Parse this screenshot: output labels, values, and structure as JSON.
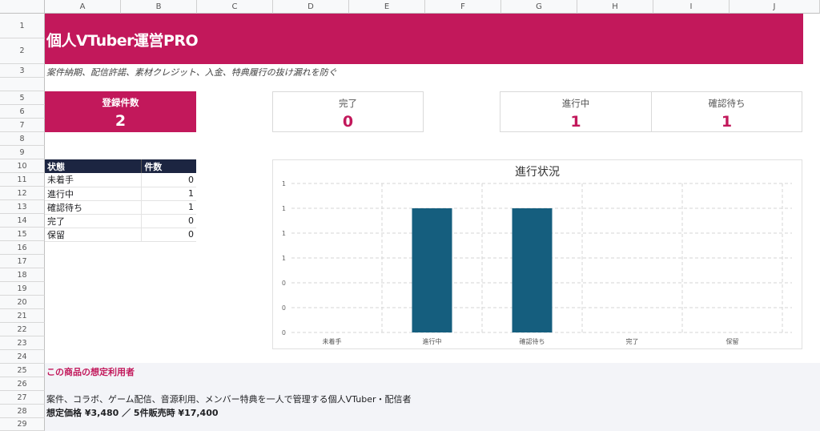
{
  "sheet": {
    "columns": [
      "A",
      "B",
      "C",
      "D",
      "E",
      "F",
      "G",
      "H",
      "I",
      "J"
    ],
    "rows": [
      "1",
      "2",
      "3",
      "5",
      "6",
      "7",
      "8",
      "9",
      "10",
      "11",
      "12",
      "13",
      "14",
      "15",
      "16",
      "17",
      "18",
      "19",
      "20",
      "21",
      "22",
      "23",
      "24",
      "25",
      "26",
      "27",
      "28",
      "29"
    ]
  },
  "banner": {
    "title": "個人VTuber運営PRO"
  },
  "subtitle": "案件納期、配信許諾、素材クレジット、入金、特典履行の抜け漏れを防ぐ",
  "kpis": {
    "registered": {
      "label": "登録件数",
      "value": "2"
    },
    "done": {
      "label": "完了",
      "value": "0"
    },
    "in_progress": {
      "label": "進行中",
      "value": "1"
    },
    "awaiting": {
      "label": "確認待ち",
      "value": "1"
    }
  },
  "status_table": {
    "headers": {
      "status": "状態",
      "count": "件数"
    },
    "rows": [
      {
        "status": "未着手",
        "count": "0"
      },
      {
        "status": "進行中",
        "count": "1"
      },
      {
        "status": "確認待ち",
        "count": "1"
      },
      {
        "status": "完了",
        "count": "0"
      },
      {
        "status": "保留",
        "count": "0"
      }
    ]
  },
  "chart_data": {
    "type": "bar",
    "title": "進行状況",
    "categories": [
      "未着手",
      "進行中",
      "確認待ち",
      "完了",
      "保留"
    ],
    "values": [
      0,
      1,
      1,
      0,
      0
    ],
    "ytick_labels": [
      "1",
      "1",
      "1",
      "1",
      "0",
      "0",
      "0"
    ],
    "ylim": [
      0,
      1.2
    ],
    "grid": true,
    "bar_color": "#155e7e"
  },
  "footer": {
    "section_title": "この商品の想定利用者",
    "description": "案件、コラボ、ゲーム配信、音源利用、メンバー特典を一人で管理する個人VTuber・配信者",
    "price": "想定価格 ¥3,480 ／ 5件販売時 ¥17,400"
  },
  "colors": {
    "accent": "#c2185b",
    "header_dark": "#1c2541",
    "bar": "#155e7e"
  }
}
